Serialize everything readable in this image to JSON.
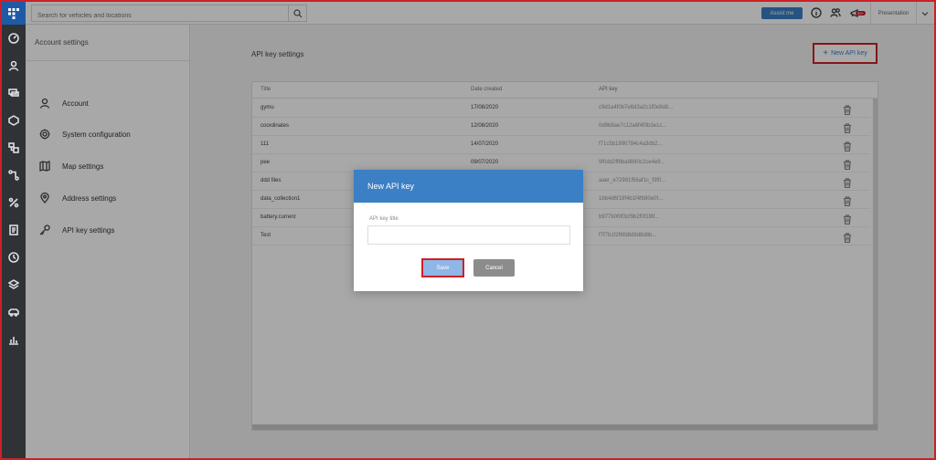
{
  "topbar": {
    "search_placeholder": "Search for vehicles and locations",
    "assist_label": "Assist me",
    "notification_badge": "99+",
    "profile_menu": "Presentation"
  },
  "rail": {
    "icons": [
      "dashboard-icon",
      "user-icon",
      "chat-icon",
      "route-icon",
      "fleet-icon",
      "flow-icon",
      "tools-icon",
      "report-icon",
      "history-icon",
      "layers-icon",
      "vehicle-icon",
      "stats-icon"
    ]
  },
  "sidebar": {
    "title": "Account settings",
    "items": [
      {
        "label": "Account",
        "icon": "user-icon"
      },
      {
        "label": "System configuration",
        "icon": "gear-icon"
      },
      {
        "label": "Map settings",
        "icon": "map-icon"
      },
      {
        "label": "Address settings",
        "icon": "location-pin-icon"
      },
      {
        "label": "API key settings",
        "icon": "key-icon"
      }
    ]
  },
  "main": {
    "title": "API key settings",
    "new_key_label": "New API key",
    "columns": [
      "Title",
      "Date created",
      "API key"
    ],
    "rows": [
      {
        "title": "gymu",
        "date": "17/08/2020",
        "key": "c9d1a4f0b7e6d3a2c1f0e9d8..."
      },
      {
        "title": "coordinates",
        "date": "12/08/2020",
        "key": "0d9b8ae7c12a6f4f0b3e1c..."
      },
      {
        "title": "111",
        "date": "14/07/2020",
        "key": "f71c5b1990784c4a3db2..."
      },
      {
        "title": "pee",
        "date": "09/07/2020",
        "key": "9f0dd2ff6ba8880c2ce4e9..."
      },
      {
        "title": "ddd files",
        "date": "",
        "key": "aaer_e72981f56af1c_f3f0..."
      },
      {
        "title": "data_collection1",
        "date": "",
        "key": "1bb4d6f19f4b1f4fb90e0f..."
      },
      {
        "title": "battery.current",
        "date": "",
        "key": "b977b0f0f3cf9b2f0f1f8f..."
      },
      {
        "title": "Test",
        "date": "",
        "key": "f7f7b1f2f6fd8d8d8d8b..."
      }
    ]
  },
  "modal": {
    "title": "New API key",
    "field_label": "API key title",
    "field_value": "",
    "save_label": "Save",
    "cancel_label": "Cancel"
  },
  "colors": {
    "accent": "#3b7fc4",
    "highlight_red": "#cc2027",
    "rail_bg": "#2f3336"
  }
}
